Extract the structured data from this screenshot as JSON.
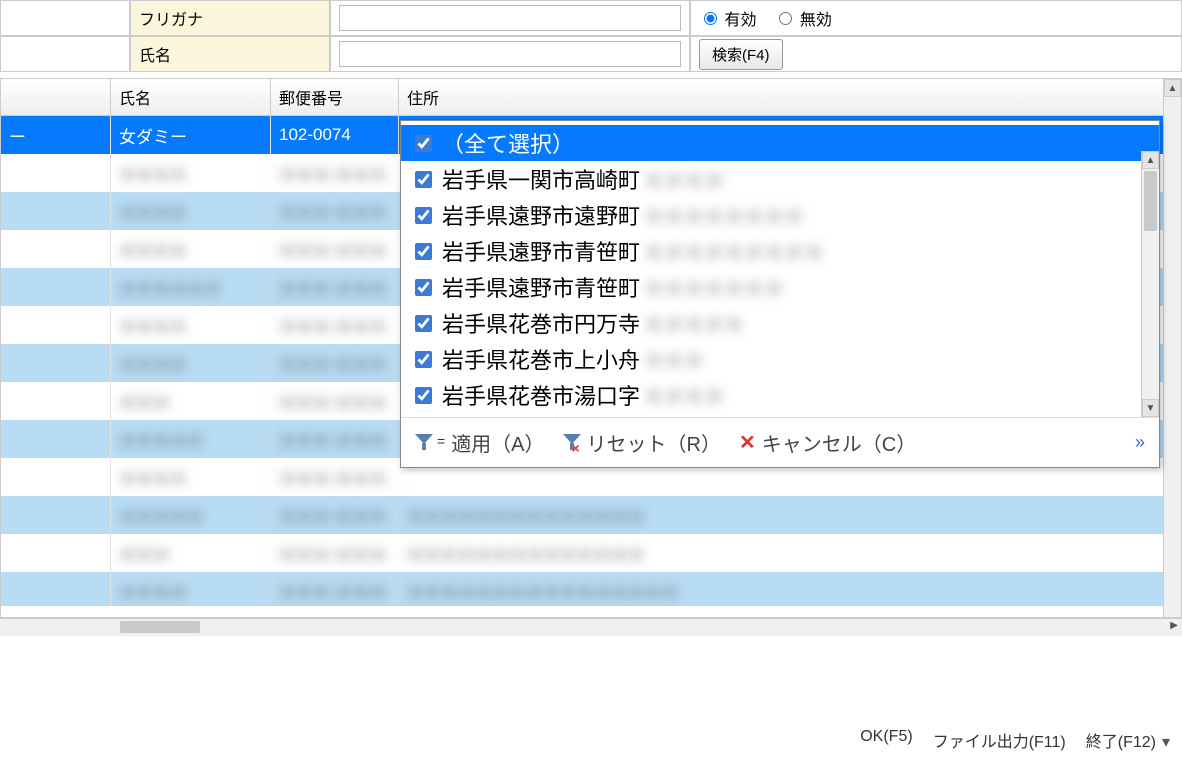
{
  "form": {
    "furigana_label": "フリガナ",
    "name_label": "氏名",
    "furigana_value": "",
    "name_value": "",
    "radio_valid": "有効",
    "radio_invalid": "無効",
    "search_btn": "検索(F4)"
  },
  "grid": {
    "headers": {
      "col1": "氏名",
      "col2": "郵便番号",
      "col3": "住所"
    },
    "rows": [
      {
        "sel": true,
        "c0": "ー",
        "c1": "女ダミー",
        "c2": "102-0074",
        "c3": ""
      },
      {
        "c1": "＊＊＊＊",
        "c2": "＊＊＊-＊＊＊",
        "c3": ""
      },
      {
        "alt": true,
        "c1": "＊＊＊＊",
        "c2": "＊＊＊-＊＊＊",
        "c3": ""
      },
      {
        "c1": "＊＊＊＊",
        "c2": "＊＊＊-＊＊＊",
        "c3": ""
      },
      {
        "alt": true,
        "c1": "＊＊＊＊＊＊",
        "c2": "＊＊＊-＊＊＊",
        "c3": ""
      },
      {
        "c1": "＊＊＊＊",
        "c2": "＊＊＊-＊＊＊",
        "c3": ""
      },
      {
        "alt": true,
        "c1": "＊＊＊＊",
        "c2": "＊＊＊-＊＊＊",
        "c3": ""
      },
      {
        "c1": "＊＊＊",
        "c2": "＊＊＊-＊＊＊",
        "c3": ""
      },
      {
        "alt": true,
        "c1": "＊＊＊＊＊",
        "c2": "＊＊＊-＊＊＊",
        "c3": ""
      },
      {
        "c1": "＊＊＊＊",
        "c2": "＊＊＊-＊＊＊",
        "c3": ""
      },
      {
        "alt": true,
        "c1": "＊＊＊＊＊",
        "c2": "＊＊＊-＊＊＊",
        "c3": "＊＊＊＊＊＊＊＊＊＊＊＊＊＊"
      },
      {
        "c1": "＊＊＊",
        "c2": "＊＊＊-＊＊＊",
        "c3": "＊＊＊＊＊＊＊＊＊＊＊＊＊＊"
      },
      {
        "alt": true,
        "c1": "＊＊＊＊",
        "c2": "＊＊＊-＊＊＊",
        "c3": "＊＊＊＊＊＊＊＊＊＊＊＊＊＊＊＊"
      },
      {
        "c1": "＊＊＊＊",
        "c2": "＊＊＊-＊＊＊",
        "c3": "＊＊＊＊＊＊＊＊＊＊＊＊＊＊"
      },
      {
        "alt": true,
        "c1": "＊＊＊＊",
        "c2": "＊＊＊-＊＊＊",
        "c3": "＊＊＊＊＊＊＊＊＊＊＊＊＊＊＊＊"
      }
    ]
  },
  "filter_popup": {
    "select_all": "（全て選択）",
    "items": [
      {
        "label": "岩手県一関市高崎町",
        "extra": "＊＊＊＊"
      },
      {
        "label": "岩手県遠野市遠野町",
        "extra": "＊＊＊＊＊＊＊＊"
      },
      {
        "label": "岩手県遠野市青笹町",
        "extra": "＊＊＊＊＊＊＊＊＊"
      },
      {
        "label": "岩手県遠野市青笹町",
        "extra": "＊＊＊＊＊＊＊"
      },
      {
        "label": "岩手県花巻市円万寺",
        "extra": "＊＊＊＊＊"
      },
      {
        "label": "岩手県花巻市上小舟",
        "extra": "＊＊＊"
      },
      {
        "label": "岩手県花巻市湯口字",
        "extra": "＊＊＊＊"
      }
    ],
    "apply": "適用（A）",
    "reset": "リセット（R）",
    "cancel": "キャンセル（C）"
  },
  "footer": {
    "ok": "OK(F5)",
    "export": "ファイル出力(F11)",
    "close": "終了(F12)"
  }
}
